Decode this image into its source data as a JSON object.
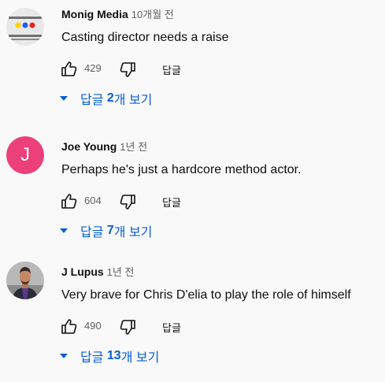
{
  "comments": [
    {
      "author": "Monig Media",
      "time": "10개월 전",
      "text": "Casting director needs a raise",
      "likes": "429",
      "reply_label": "답글",
      "replies": {
        "prefix": "답글 ",
        "count": "2",
        "suffix": "개 보기"
      },
      "avatar": {
        "type": "dots",
        "bg": "#e8e8e8",
        "dots": [
          "#ffd400",
          "#1a5cff",
          "#e52222"
        ]
      }
    },
    {
      "author": "Joe Young",
      "time": "1년 전",
      "text": "Perhaps he's just a hardcore method actor.",
      "likes": "604",
      "reply_label": "답글",
      "replies": {
        "prefix": "답글 ",
        "count": "7",
        "suffix": "개 보기"
      },
      "avatar": {
        "type": "letter",
        "letter": "J",
        "bg": "#ec407a"
      }
    },
    {
      "author": "J Lupus",
      "time": "1년 전",
      "text": "Very brave for Chris D'elia to play the role of himself",
      "likes": "490",
      "reply_label": "답글",
      "replies": {
        "prefix": "답글 ",
        "count": "13",
        "suffix": "개 보기"
      },
      "avatar": {
        "type": "photo",
        "bg": "#b9b9b9"
      }
    }
  ],
  "colors": {
    "link": "#065fd4",
    "secondary": "#606060",
    "text": "#0f0f0f",
    "background": "#f9f9f9"
  },
  "icons": {
    "like": "thumb-up-icon",
    "dislike": "thumb-down-icon",
    "expand": "caret-down-icon"
  }
}
